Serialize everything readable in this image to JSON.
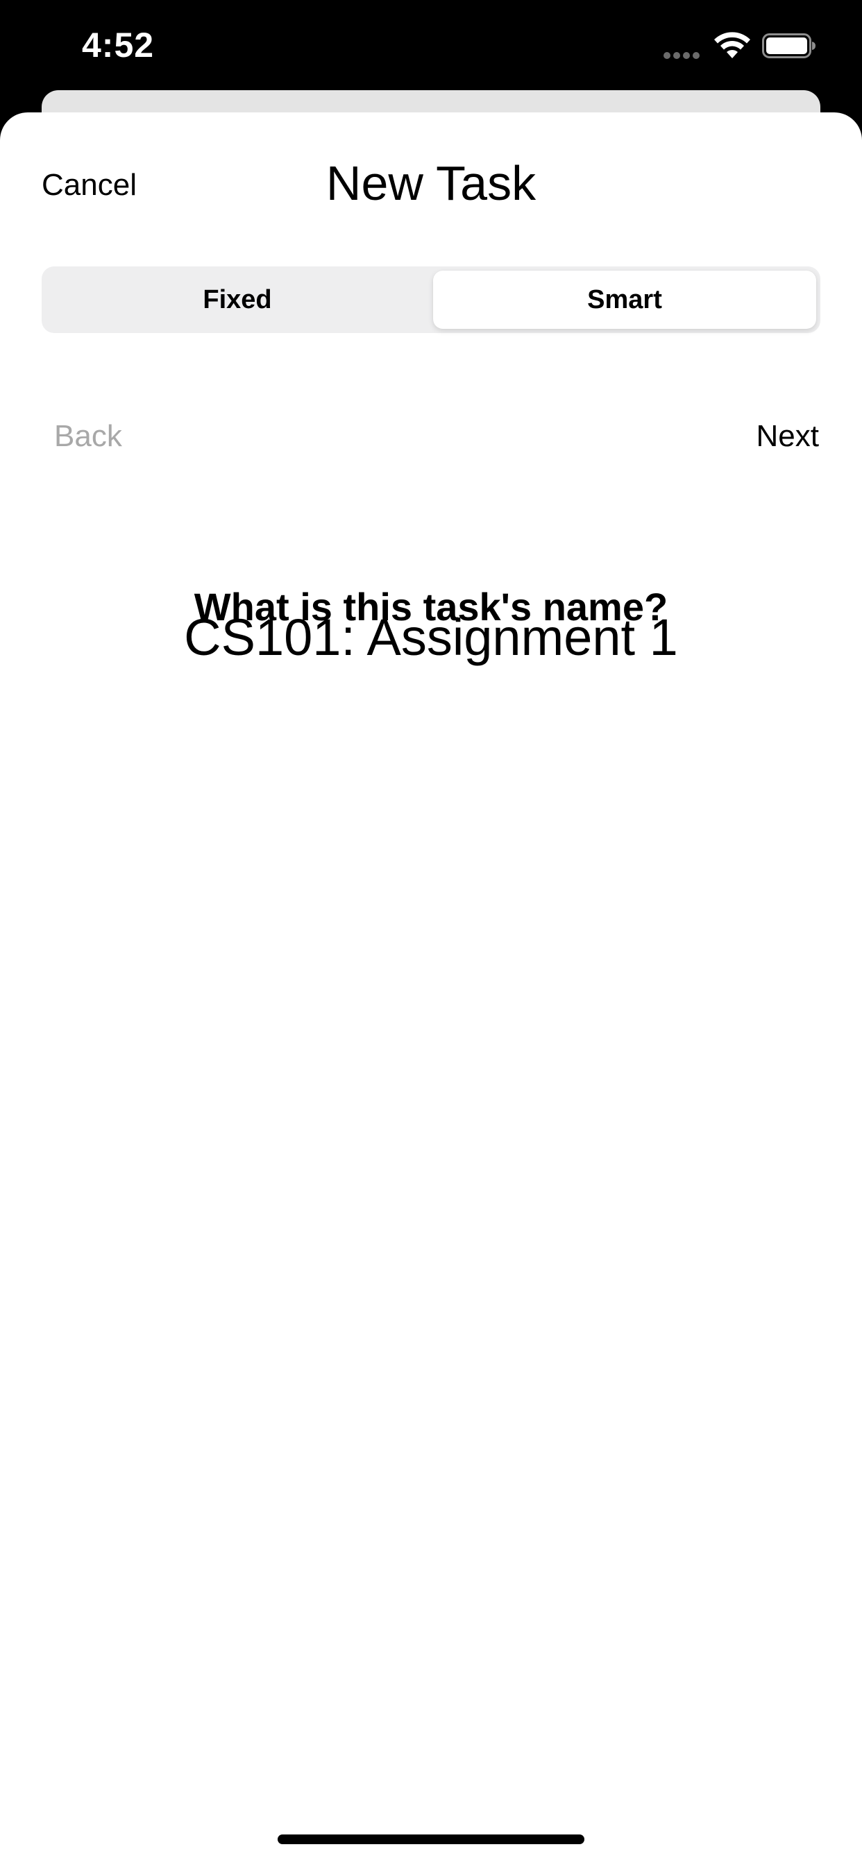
{
  "status_bar": {
    "time": "4:52",
    "signal_icon": "signal-dots-icon",
    "wifi_icon": "wifi-icon",
    "battery_icon": "battery-icon"
  },
  "sheet": {
    "cancel_label": "Cancel",
    "title": "New Task"
  },
  "segmented_control": {
    "options": [
      "Fixed",
      "Smart"
    ],
    "selected": "Smart"
  },
  "navigation": {
    "back_label": "Back",
    "back_enabled": false,
    "next_label": "Next"
  },
  "question": {
    "text": "What is this task's name?",
    "answer_value": "CS101: Assignment 1"
  },
  "colors": {
    "status_bar_background": "#000000",
    "sheet_background": "#ffffff",
    "disabled_text": "#a8a8a8",
    "segment_track": "#eeeeef"
  }
}
